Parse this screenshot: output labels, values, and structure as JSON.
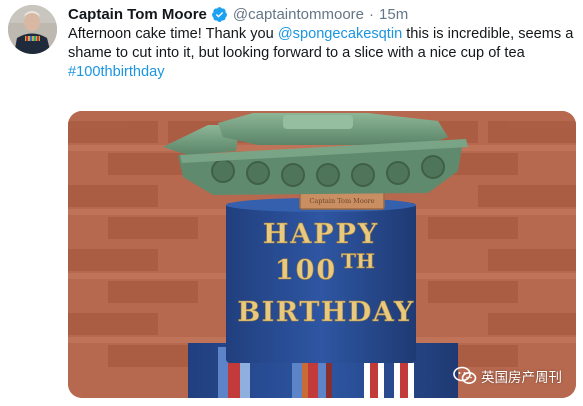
{
  "tweet": {
    "author_name": "Captain Tom Moore",
    "handle": "@captaintommoore",
    "separator": "·",
    "time": "15m",
    "text_before_mention": "Afternoon cake time! Thank you ",
    "mention": "@spongecakesqtin",
    "text_after_mention": " this is incredible, seems a shame to cut into it, but looking forward to a slice with a nice cup of tea",
    "hashtag": "#100thbirthday"
  },
  "image": {
    "cake_line1": "HAPPY",
    "cake_line2": "100",
    "cake_line2_suffix": "TH",
    "cake_line3": "BIRTHDAY",
    "plaque_text": "Captain Tom Moore"
  },
  "watermark": {
    "label": "英国房产周刊",
    "icon": "wechat-icon"
  },
  "colors": {
    "link": "#1b95e0",
    "verified": "#1da1f2",
    "cake_blue": "#2b4f9a",
    "cake_gold": "#e8c97e",
    "tank_green": "#6f9b7c",
    "brick": "#b5664e"
  }
}
